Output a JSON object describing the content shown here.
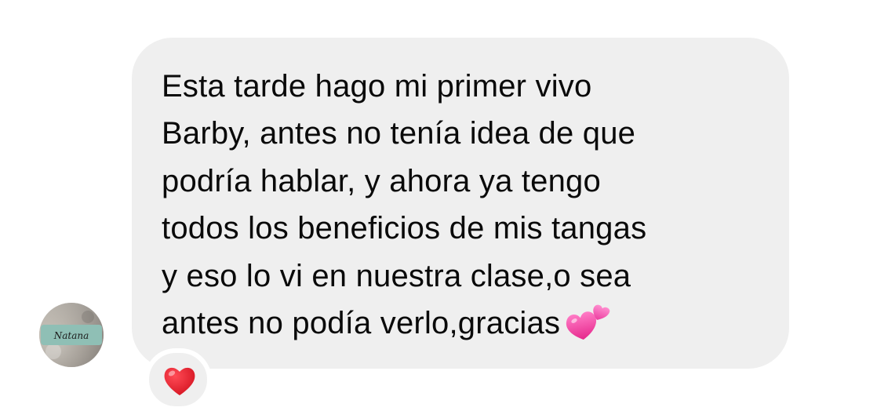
{
  "conversation": {
    "message": {
      "lines": [
        "Esta tarde hago mi primer vivo",
        "Barby, antes no tenía idea de que",
        "podría hablar, y ahora ya tengo",
        "todos los beneficios de mis tangas",
        "y eso lo vi en nuestra clase,o sea",
        "antes no podía verlo,gracias"
      ],
      "trailing_emoji": "two-hearts-icon",
      "reaction": "red-heart-icon"
    },
    "sender_avatar": {
      "label": "Natana"
    }
  },
  "colors": {
    "bubble_background": "#efefef",
    "text": "#0a0a0a",
    "heart_pink": "#ee3d9b",
    "heart_red": "#e0182d"
  }
}
